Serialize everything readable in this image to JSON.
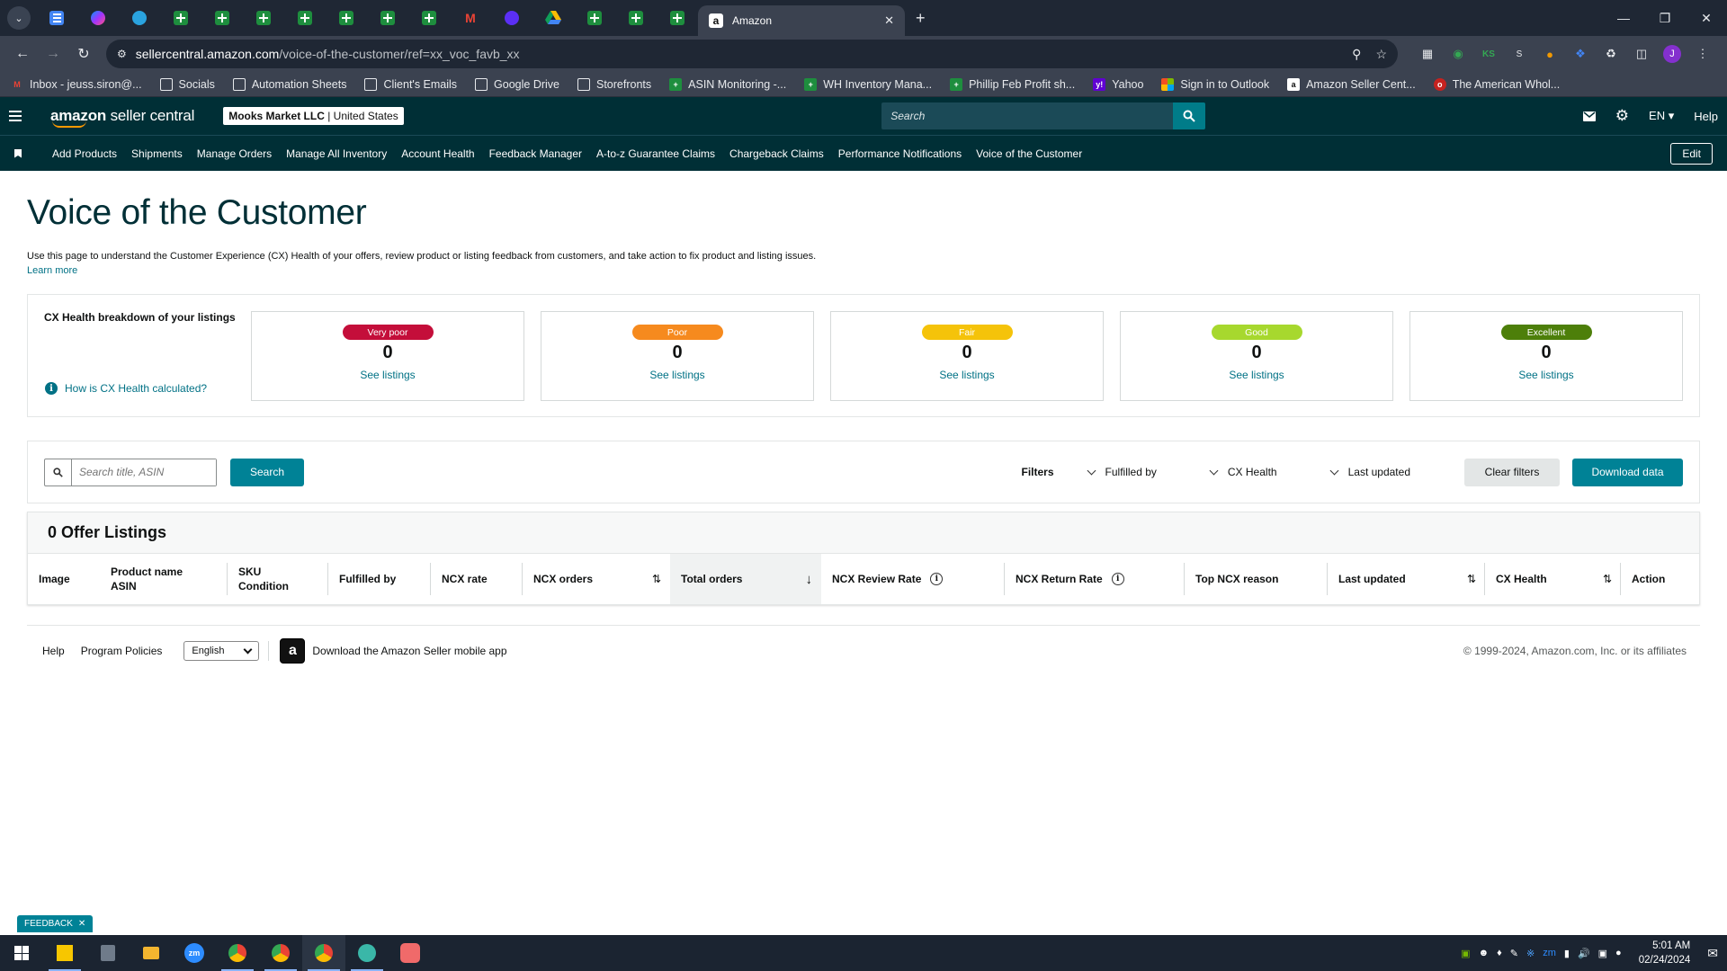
{
  "browser": {
    "tabs_pinned": [
      "docs",
      "messenger",
      "telegram",
      "sheets",
      "sheets",
      "sheets",
      "sheets",
      "sheets",
      "sheets",
      "sheets",
      "gmail",
      "purple",
      "drive",
      "sheets",
      "sheets",
      "sheets"
    ],
    "active_tab": {
      "title": "Amazon",
      "favicon": "amazon-icon"
    },
    "address": {
      "site": "sellercentral.amazon.com",
      "path": "/voice-of-the-customer/ref=xx_voc_favb_xx"
    },
    "profile_initial": "J",
    "bookmarks": [
      {
        "label": "Inbox - jeuss.siron@...",
        "icon": "gmail"
      },
      {
        "label": "Socials",
        "icon": "folder"
      },
      {
        "label": "Automation Sheets",
        "icon": "folder"
      },
      {
        "label": "Client's Emails",
        "icon": "folder"
      },
      {
        "label": "Google Drive",
        "icon": "folder"
      },
      {
        "label": "Storefronts",
        "icon": "folder"
      },
      {
        "label": "ASIN Monitoring -...",
        "icon": "sheets"
      },
      {
        "label": "WH Inventory Mana...",
        "icon": "sheets"
      },
      {
        "label": "Phillip Feb Profit sh...",
        "icon": "sheets"
      },
      {
        "label": "Yahoo",
        "icon": "yahoo"
      },
      {
        "label": "Sign in to Outlook",
        "icon": "microsoft"
      },
      {
        "label": "Amazon Seller Cent...",
        "icon": "amazon"
      },
      {
        "label": "The American Whol...",
        "icon": "globe"
      }
    ]
  },
  "header": {
    "logo_bold": "amazon",
    "logo_light": " seller central",
    "account_name": "Mooks Market LLC",
    "account_region": " | United States",
    "search_placeholder": "Search",
    "language": "EN",
    "help": "Help"
  },
  "nav": {
    "links": [
      "Add Products",
      "Shipments",
      "Manage Orders",
      "Manage All Inventory",
      "Account Health",
      "Feedback Manager",
      "A-to-z Guarantee Claims",
      "Chargeback Claims",
      "Performance Notifications",
      "Voice of the Customer"
    ],
    "edit": "Edit"
  },
  "page": {
    "title": "Voice of the Customer",
    "intro": "Use this page to understand the Customer Experience (CX) Health of your offers, review product or listing feedback from customers, and take action to fix product and listing issues.",
    "learn_more": "Learn more"
  },
  "cx_health": {
    "label": "CX Health breakdown of your listings",
    "help_link": "How is CX Health calculated?",
    "cards": [
      {
        "badge": "Very poor",
        "count": "0",
        "link": "See listings",
        "color": "#c40e3a"
      },
      {
        "badge": "Poor",
        "count": "0",
        "link": "See listings",
        "color": "#f68a1e"
      },
      {
        "badge": "Fair",
        "count": "0",
        "link": "See listings",
        "color": "#f5c30a"
      },
      {
        "badge": "Good",
        "count": "0",
        "link": "See listings",
        "color": "#a7d82e"
      },
      {
        "badge": "Excellent",
        "count": "0",
        "link": "See listings",
        "color": "#4d7f0a"
      }
    ]
  },
  "filters": {
    "search_placeholder": "Search title, ASIN",
    "search_button": "Search",
    "label": "Filters",
    "dropdowns": [
      "Fulfilled by",
      "CX Health",
      "Last updated"
    ],
    "clear": "Clear filters",
    "download": "Download data"
  },
  "offers": {
    "heading": "0 Offer Listings",
    "columns": {
      "image": "Image",
      "product_name": "Product name",
      "asin": "ASIN",
      "sku": "SKU",
      "condition": "Condition",
      "fulfilled_by": "Fulfilled by",
      "ncx_rate": "NCX rate",
      "ncx_orders": "NCX orders",
      "total_orders": "Total orders",
      "ncx_review_rate": "NCX Review Rate",
      "ncx_return_rate": "NCX Return Rate",
      "top_ncx_reason": "Top NCX reason",
      "last_updated": "Last updated",
      "cx_health": "CX Health",
      "action": "Action"
    }
  },
  "footer": {
    "help": "Help",
    "policies": "Program Policies",
    "language": "English",
    "app_text": "Download the Amazon Seller mobile app",
    "copyright": "© 1999-2024, Amazon.com, Inc. or its affiliates"
  },
  "feedback_tab": "FEEDBACK",
  "taskbar": {
    "time": "5:01 AM",
    "date": "02/24/2024"
  }
}
